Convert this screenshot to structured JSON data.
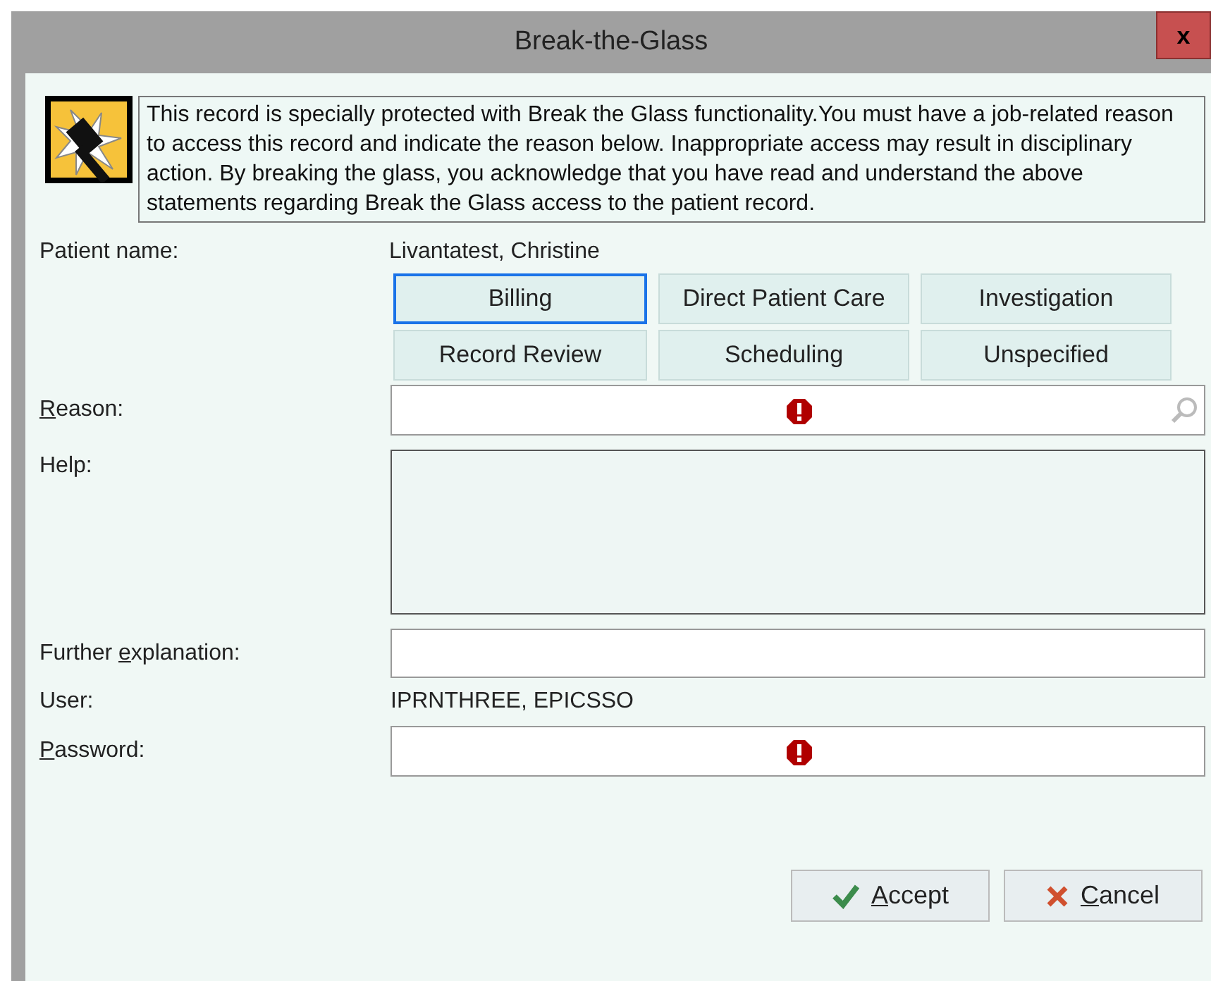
{
  "window": {
    "title": "Break-the-Glass",
    "close": "x"
  },
  "notice": "This record is specially protected with Break the Glass functionality.You must have a job-related reason to access this record and indicate the reason below. Inappropriate access may result in disciplinary action. By breaking the glass, you acknowledge that you have read and understand the above statements regarding Break the Glass access to the patient record.",
  "patient": {
    "label": "Patient name:",
    "value": "Livantatest, Christine"
  },
  "reasons": [
    {
      "label": "Billing",
      "selected": true
    },
    {
      "label": "Direct Patient Care",
      "selected": false
    },
    {
      "label": "Investigation",
      "selected": false
    },
    {
      "label": "Record Review",
      "selected": false
    },
    {
      "label": "Scheduling",
      "selected": false
    },
    {
      "label": "Unspecified",
      "selected": false
    }
  ],
  "reason_field": {
    "label": {
      "key": "R",
      "after": "eason:"
    },
    "required": true
  },
  "help": {
    "label": "Help:"
  },
  "further": {
    "label": {
      "before": "Further ",
      "key": "e",
      "after": "xplanation:"
    }
  },
  "user": {
    "label": "User:",
    "value": "IPRNTHREE, EPICSSO"
  },
  "password": {
    "label": {
      "key": "P",
      "after": "assword:"
    },
    "required": true
  },
  "buttons": [
    {
      "kind": "accept",
      "label": {
        "key": "A",
        "after": "ccept"
      }
    },
    {
      "kind": "cancel",
      "label": {
        "key": "C",
        "after": "ancel"
      }
    }
  ]
}
